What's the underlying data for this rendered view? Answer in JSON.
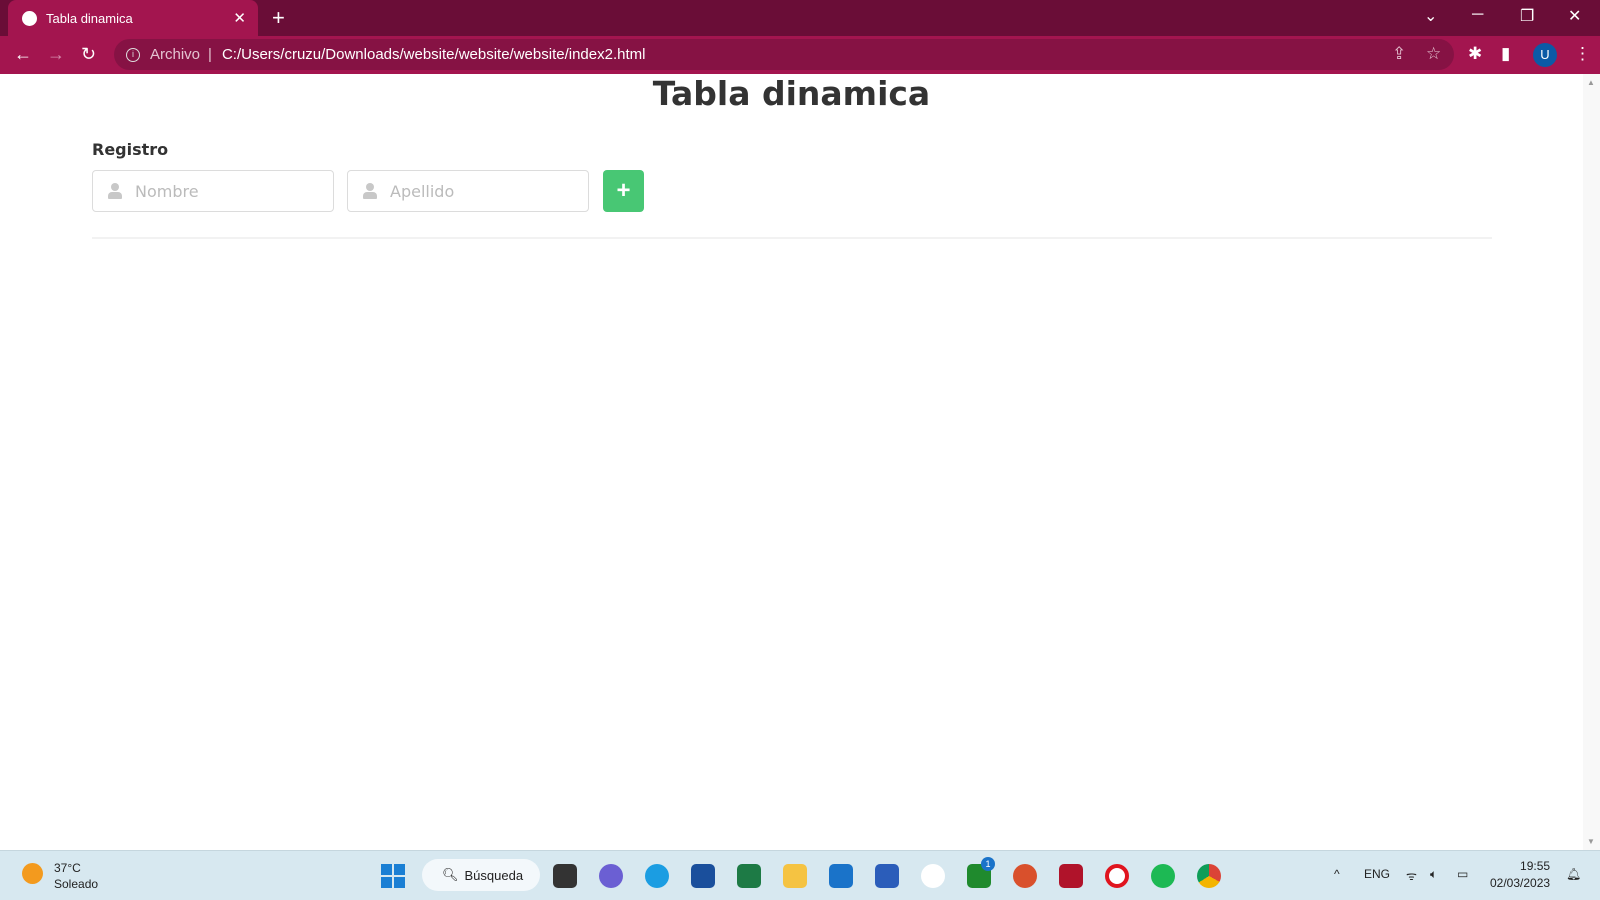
{
  "browser": {
    "tab_title": "Tabla dinamica",
    "address_scheme": "Archivo",
    "address_url": "C:/Users/cruzu/Downloads/website/website/website/index2.html",
    "profile_initial": "U",
    "theme_color": "#a3154f"
  },
  "page": {
    "title": "Tabla dinamica",
    "section_label": "Registro",
    "nombre_placeholder": "Nombre",
    "apellido_placeholder": "Apellido",
    "add_button_label": "+",
    "add_button_color": "#48c774"
  },
  "taskbar": {
    "temperature": "37°C",
    "weather": "Soleado",
    "search_label": "Búsqueda",
    "language": "ENG",
    "time": "19:55",
    "date": "02/03/2023",
    "xbox_badge": "1",
    "apps": [
      "task-view",
      "teams",
      "edge",
      "store",
      "excel",
      "file-explorer",
      "mail",
      "word",
      "app-w",
      "xbox",
      "powerpoint",
      "app-red",
      "opera",
      "spotify",
      "chrome"
    ]
  }
}
